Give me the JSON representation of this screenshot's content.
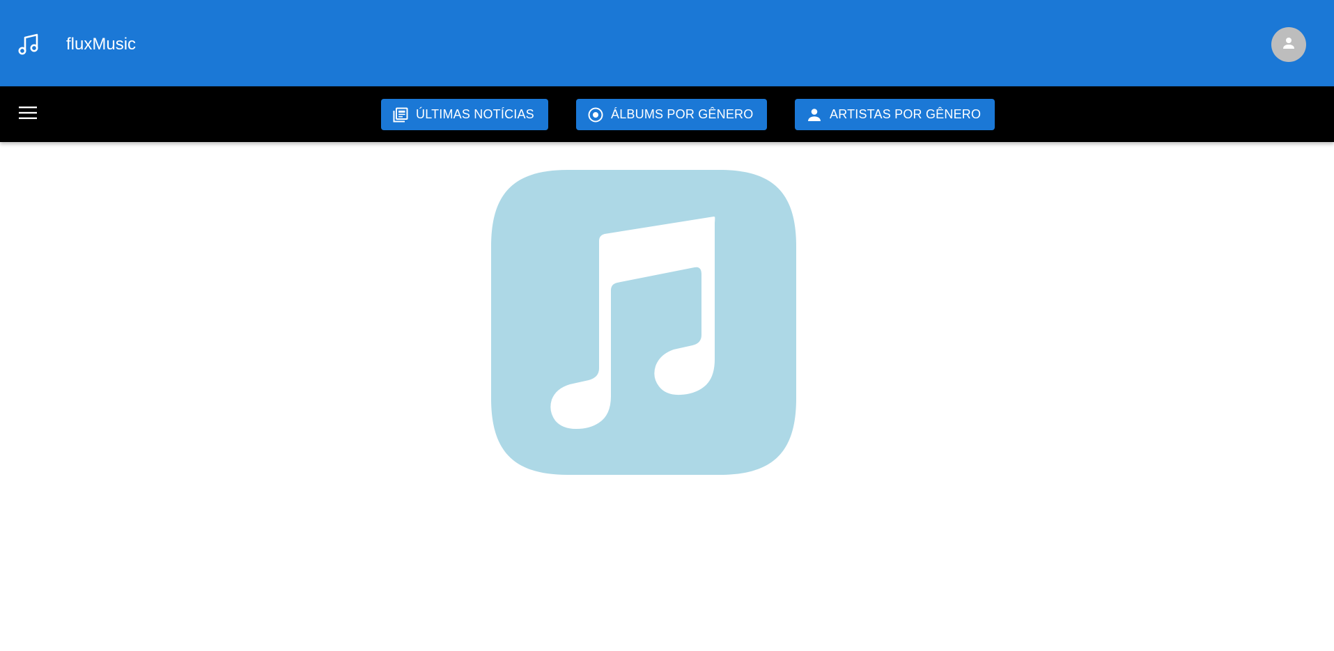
{
  "header": {
    "title": "fluxMusic",
    "brand_icon": "music-note-icon",
    "avatar_icon": "account-icon",
    "background": "#1b78d6"
  },
  "nav": {
    "background": "#000000",
    "menu_icon": "hamburger-menu-icon",
    "buttons": [
      {
        "label": "ÚLTIMAS NOTÍCIAS",
        "icon": "newspaper-icon"
      },
      {
        "label": "ÁLBUMS POR GÊNERO",
        "icon": "album-disc-icon"
      },
      {
        "label": "ARTISTAS POR GÊNERO",
        "icon": "person-icon"
      }
    ],
    "button_color": "#1b78d6"
  },
  "main": {
    "hero_icon": "music-app-icon",
    "hero_color": "#add8e6"
  }
}
